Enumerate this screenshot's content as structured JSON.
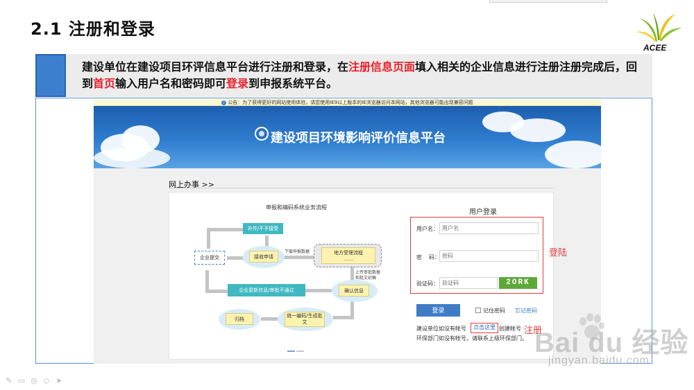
{
  "slide": {
    "title": "2.1  注册和登录",
    "logo_text": "ACEE",
    "description": {
      "part1": "建设单位在建设项目环评信息平台进行注册和登录，在",
      "hl1": "注册信息页面",
      "part2": "填入相关的企业信息进行注册注册完成后，回到",
      "hl2": "首页",
      "part3": "输入用户名和密码即可",
      "hl3": "登录",
      "part4": "到申报系统平台。"
    },
    "annotations": {
      "login": "登陆",
      "register": "注册"
    },
    "colors": {
      "accent_blue": "#3d7fcf",
      "highlight_red": "#e8202b"
    }
  },
  "site": {
    "notice": "公告：为了获得更好的网站使用体验，请您使用IE9以上版本的IE浏览器访问本网站，其他浏览器可能出现兼容问题",
    "banner_title": "建设项目环境影响评价信息平台",
    "section_label": "网上办事  >>",
    "flow": {
      "title": "申报和编码系统业务流程",
      "nodes": {
        "supplement": "补件/不予接受",
        "enterprise_submit": "企业提交",
        "receive": "接收申请",
        "local_review": "地方受理流程",
        "local_review_sub": "……",
        "confirm": "确认信息",
        "update_info": "企业更新信息/审批不通过",
        "archive": "归档",
        "generate": "统一编码/生成批文"
      },
      "labels": {
        "download": "下载申报数据",
        "upload": "上传审批数据和批文初稿"
      }
    },
    "login": {
      "title": "用户登录",
      "username_label": "用户名：",
      "username_placeholder": "用户名",
      "password_label": "密    码：",
      "password_placeholder": "密码",
      "captcha_label": "验证码：",
      "captcha_placeholder": "验证码",
      "captcha_value": "2ORK",
      "login_button": "登录",
      "remember": "记住密码",
      "forgot": "忘记密码",
      "register_prefix": "建设单位如没有帐号",
      "register_link": "点击这里",
      "register_suffix": "创建帐号",
      "env_note": "环保部门如没有帐号，请联系上级环保部门。"
    }
  },
  "watermark": {
    "brand": "Bai du 经验",
    "url": "jingyan.baidu.com"
  },
  "tools": [
    "pen-icon",
    "slides-icon",
    "cursor-icon",
    "eraser-icon",
    "arrow-icon"
  ]
}
